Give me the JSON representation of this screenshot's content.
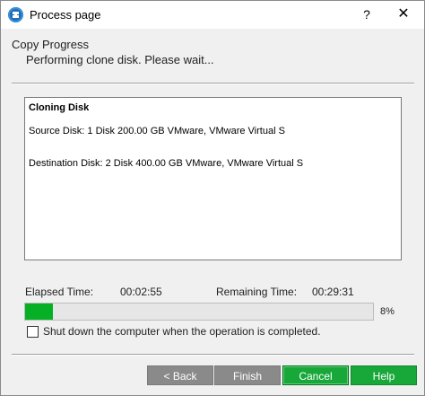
{
  "window": {
    "title": "Process page",
    "help_label": "?",
    "close_label": "✕",
    "icon": "app-logo-icon"
  },
  "header": {
    "title": "Copy Progress",
    "subtitle": "Performing clone disk. Please wait..."
  },
  "log": {
    "heading": "Cloning Disk",
    "lines": [
      "Source Disk: 1 Disk 200.00 GB VMware, VMware Virtual S",
      "Destination Disk: 2 Disk 400.00 GB VMware, VMware Virtual S"
    ]
  },
  "times": {
    "elapsed_label": "Elapsed Time:",
    "elapsed_value": "00:02:55",
    "remaining_label": "Remaining Time:",
    "remaining_value": "00:29:31"
  },
  "progress": {
    "percent": 8,
    "label": "8%",
    "color": "#06b025"
  },
  "shutdown_option": {
    "label": "Shut down the computer when the operation is completed.",
    "checked": false
  },
  "buttons": {
    "back": "< Back",
    "finish": "Finish",
    "cancel": "Cancel",
    "help": "Help"
  }
}
